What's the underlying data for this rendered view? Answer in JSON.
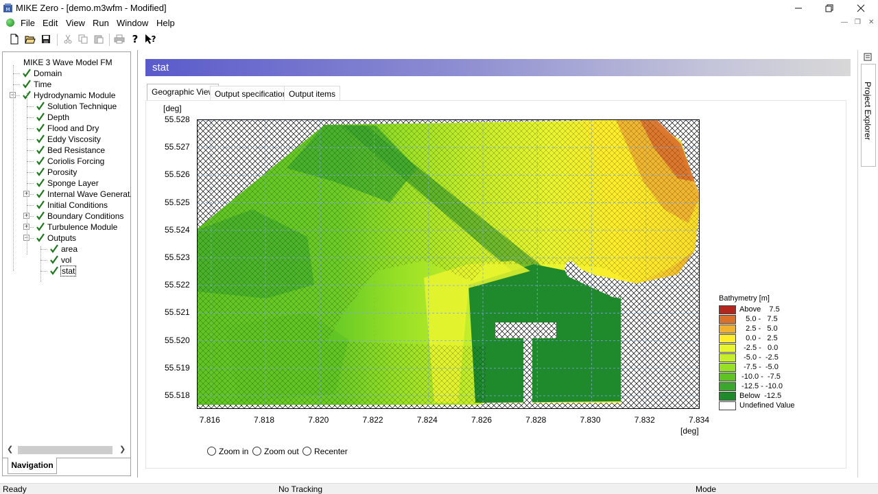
{
  "window": {
    "title": "MIKE Zero - [demo.m3wfm - Modified]",
    "minimize_icon": "minimize-icon",
    "maximize_icon": "restore-icon",
    "close_icon": "close-icon"
  },
  "menu": [
    "File",
    "Edit",
    "View",
    "Run",
    "Window",
    "Help"
  ],
  "toolbar": [
    "new-icon",
    "open-icon",
    "save-icon",
    "cut-icon",
    "copy-icon",
    "paste-icon",
    "print-icon",
    "help-icon",
    "context-help-icon"
  ],
  "navigation": {
    "tab_label": "Navigation",
    "tree": [
      {
        "label": "MIKE 3 Wave Model FM",
        "level": 0,
        "checked": false
      },
      {
        "label": "Domain",
        "level": 1,
        "checked": true
      },
      {
        "label": "Time",
        "level": 1,
        "checked": true
      },
      {
        "label": "Hydrodynamic Module",
        "level": 1,
        "checked": true,
        "expander": "minus"
      },
      {
        "label": "Solution Technique",
        "level": 2,
        "checked": true
      },
      {
        "label": "Depth",
        "level": 2,
        "checked": true
      },
      {
        "label": "Flood and Dry",
        "level": 2,
        "checked": true
      },
      {
        "label": "Eddy Viscosity",
        "level": 2,
        "checked": true
      },
      {
        "label": "Bed Resistance",
        "level": 2,
        "checked": true
      },
      {
        "label": "Coriolis Forcing",
        "level": 2,
        "checked": true
      },
      {
        "label": "Porosity",
        "level": 2,
        "checked": true
      },
      {
        "label": "Sponge Layer",
        "level": 2,
        "checked": true
      },
      {
        "label": "Internal Wave Generat...",
        "level": 2,
        "checked": true,
        "expander": "plus"
      },
      {
        "label": "Initial Conditions",
        "level": 2,
        "checked": true
      },
      {
        "label": "Boundary Conditions",
        "level": 2,
        "checked": true,
        "expander": "plus"
      },
      {
        "label": "Turbulence Module",
        "level": 2,
        "checked": true,
        "expander": "plus"
      },
      {
        "label": "Outputs",
        "level": 2,
        "checked": true,
        "expander": "minus"
      },
      {
        "label": "area",
        "level": 3,
        "checked": true
      },
      {
        "label": "vol",
        "level": 3,
        "checked": true
      },
      {
        "label": "stat",
        "level": 3,
        "checked": true,
        "selected": true
      }
    ]
  },
  "main": {
    "header": "stat",
    "tabs": [
      "Geographic View",
      "Output specification",
      "Output items"
    ],
    "active_tab": "Geographic View"
  },
  "chart_data": {
    "type": "heatmap",
    "title": "",
    "ylabel": "[deg]",
    "xlabel": "[deg]",
    "x_ticks": [
      "7.816",
      "7.818",
      "7.820",
      "7.822",
      "7.824",
      "7.826",
      "7.828",
      "7.830",
      "7.832",
      "7.834"
    ],
    "y_ticks": [
      "55.528",
      "55.527",
      "55.526",
      "55.525",
      "55.524",
      "55.523",
      "55.522",
      "55.521",
      "55.520",
      "55.519",
      "55.518"
    ],
    "xlim": [
      7.8155,
      7.834
    ],
    "ylim": [
      55.5175,
      55.528
    ],
    "grid": true,
    "legend_title": "Bathymetry [m]",
    "legend_placement": "right",
    "legend": [
      {
        "label": "Above    7.5",
        "color": "#b3261e"
      },
      {
        "label": "   5.0 -   7.5",
        "color": "#d9702b"
      },
      {
        "label": "   2.5 -   5.0",
        "color": "#f0b030"
      },
      {
        "label": "   0.0 -   2.5",
        "color": "#ffec2a"
      },
      {
        "label": "  -2.5 -   0.0",
        "color": "#e9f52e"
      },
      {
        "label": "  -5.0 -  -2.5",
        "color": "#c6ee2a"
      },
      {
        "label": "  -7.5 -  -5.0",
        "color": "#97e026"
      },
      {
        "label": " -10.0 -  -7.5",
        "color": "#5fc423"
      },
      {
        "label": " -12.5 - -10.0",
        "color": "#3ba72d"
      },
      {
        "label": "Below  -12.5",
        "color": "#1f8a2b"
      },
      {
        "label": "Undefined Value",
        "color": "#ffffff"
      }
    ]
  },
  "view_controls": [
    "Zoom in",
    "Zoom out",
    "Recenter"
  ],
  "right_panel": {
    "label": "Project Explorer",
    "icon": "project-explorer-icon"
  },
  "status": {
    "left": "Ready",
    "middle": "No Tracking",
    "right": "Mode"
  }
}
